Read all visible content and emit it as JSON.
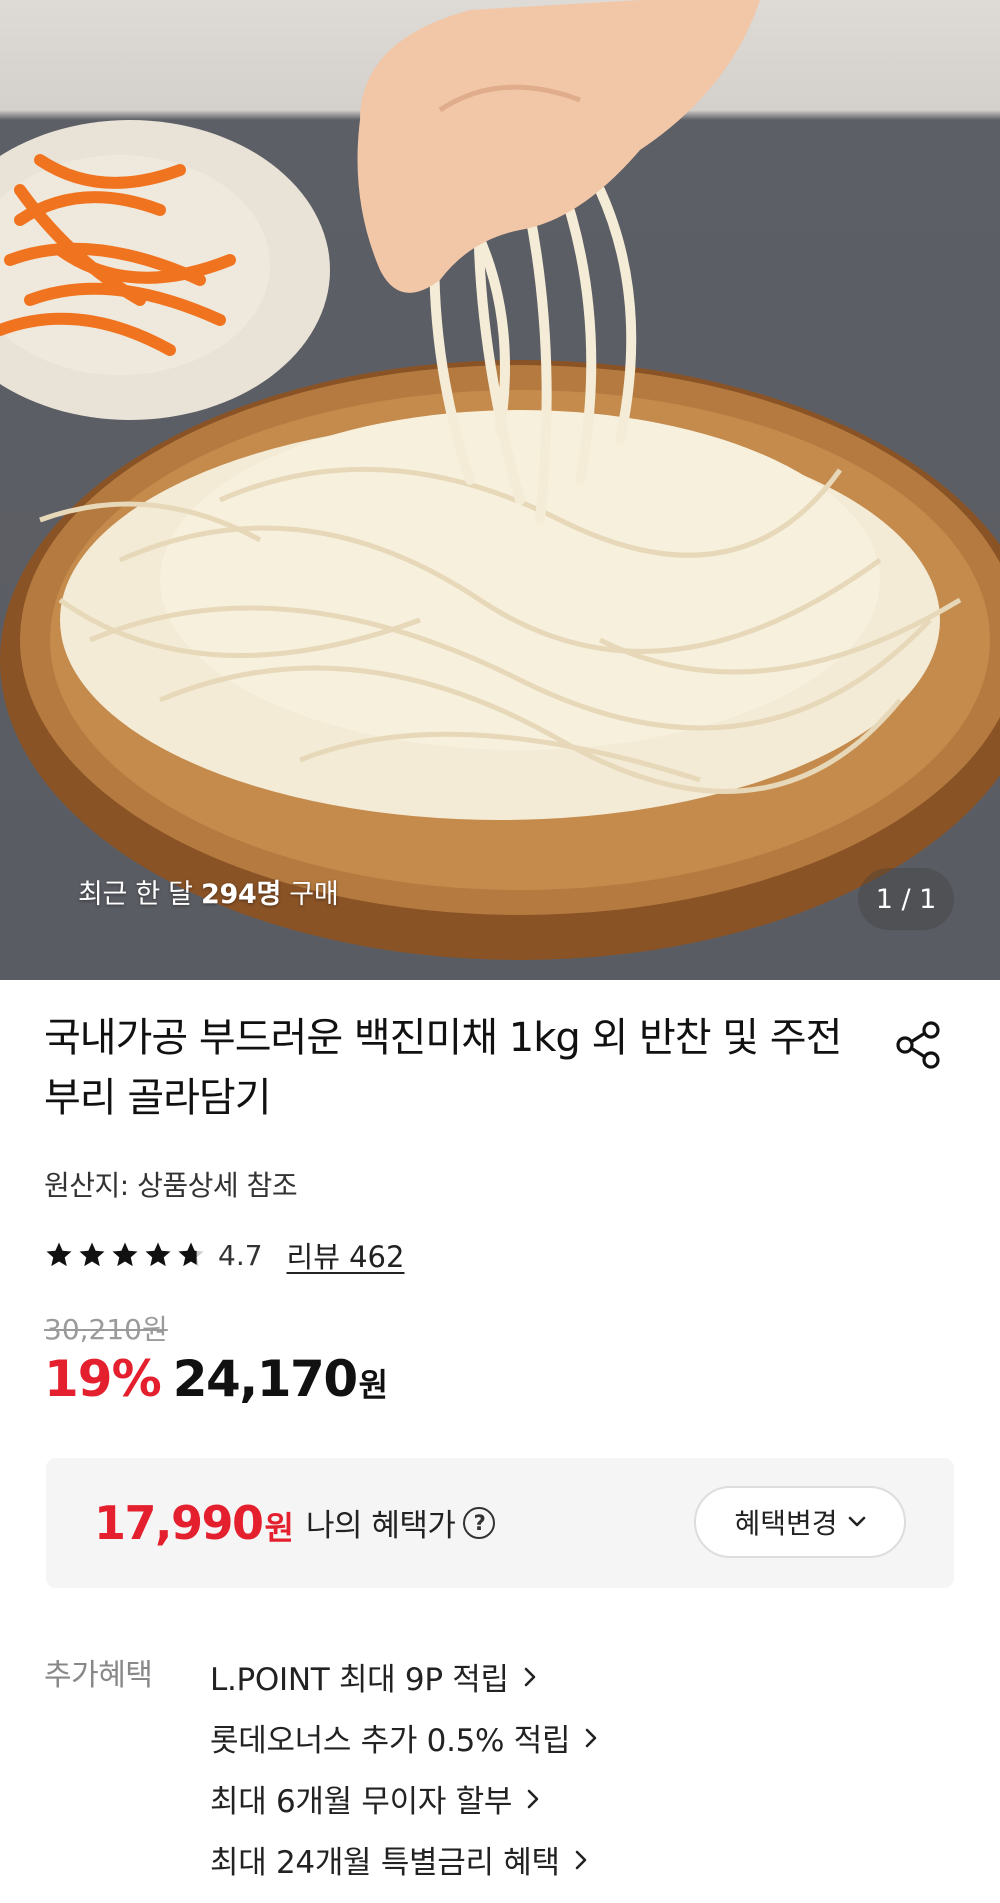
{
  "hero": {
    "caption_prefix": "최근 한 달 ",
    "caption_count": "294명",
    "caption_suffix": " 구매",
    "counter": "1 / 1"
  },
  "product": {
    "title": "국내가공 부드러운 백진미채 1kg 외 반찬 및 주전부리 골라담기",
    "origin": "원산지: 상품상세 참조",
    "rating": "4.7",
    "rating_stars": 4.7,
    "review_link": "리뷰 462",
    "original_price": "30,210원",
    "discount": "19%",
    "price": "24,170",
    "price_unit": "원"
  },
  "benefit": {
    "my_price": "17,990",
    "my_price_unit": "원",
    "my_price_label": "나의 혜택가",
    "change_button": "혜택변경"
  },
  "extra": {
    "label": "추가혜택",
    "items": [
      "L.POINT 최대 9P 적립",
      "롯데오너스 추가 0.5% 적립",
      "최대 6개월 무이자 할부",
      "최대 24개월 특별금리 혜택"
    ]
  },
  "colors": {
    "accent_red": "#e4202e",
    "benefit_bg": "#f5f5f5"
  },
  "icons": {
    "share": "share-icon",
    "star": "star-icon",
    "help": "question-circle-icon",
    "chevron_down": "chevron-down-icon",
    "chevron_right": "chevron-right-icon"
  }
}
